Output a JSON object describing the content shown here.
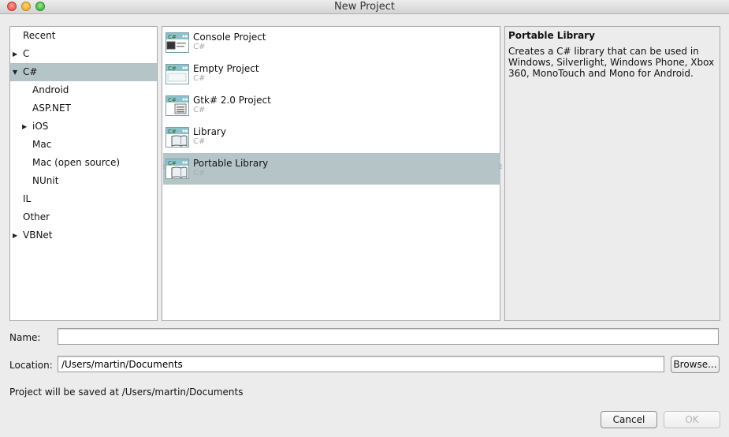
{
  "window": {
    "title": "New Project"
  },
  "categories": {
    "items": [
      {
        "label": "Recent",
        "has_children": false,
        "expanded": false,
        "level": 0,
        "selected": false
      },
      {
        "label": "C",
        "has_children": true,
        "expanded": false,
        "level": 0,
        "selected": false
      },
      {
        "label": "C#",
        "has_children": true,
        "expanded": true,
        "level": 0,
        "selected": true
      },
      {
        "label": "Android",
        "has_children": false,
        "expanded": false,
        "level": 1,
        "selected": false
      },
      {
        "label": "ASP.NET",
        "has_children": false,
        "expanded": false,
        "level": 1,
        "selected": false
      },
      {
        "label": "iOS",
        "has_children": true,
        "expanded": false,
        "level": 1,
        "selected": false
      },
      {
        "label": "Mac",
        "has_children": false,
        "expanded": false,
        "level": 1,
        "selected": false
      },
      {
        "label": "Mac (open source)",
        "has_children": false,
        "expanded": false,
        "level": 1,
        "selected": false
      },
      {
        "label": "NUnit",
        "has_children": false,
        "expanded": false,
        "level": 1,
        "selected": false
      },
      {
        "label": "IL",
        "has_children": false,
        "expanded": false,
        "level": 0,
        "selected": false
      },
      {
        "label": "Other",
        "has_children": false,
        "expanded": false,
        "level": 0,
        "selected": false
      },
      {
        "label": "VBNet",
        "has_children": true,
        "expanded": false,
        "level": 0,
        "selected": false
      }
    ]
  },
  "templates": {
    "items": [
      {
        "name": "Console Project",
        "language": "C#",
        "icon": "console-project-icon",
        "icon_badge": "C#",
        "selected": false
      },
      {
        "name": "Empty Project",
        "language": "C#",
        "icon": "empty-project-icon",
        "icon_badge": "C#",
        "selected": false
      },
      {
        "name": "Gtk# 2.0 Project",
        "language": "C#",
        "icon": "gtk-project-icon",
        "icon_badge": "C#",
        "selected": false
      },
      {
        "name": "Library",
        "language": "C#",
        "icon": "library-icon",
        "icon_badge": "C#",
        "selected": false
      },
      {
        "name": "Portable Library",
        "language": "C#",
        "icon": "portable-library-icon",
        "icon_badge": "C#",
        "selected": true
      }
    ]
  },
  "description": {
    "title": "Portable Library",
    "body": "Creates a C# library that can be used in Windows, Silverlight, Windows Phone, Xbox 360, MonoTouch and Mono for Android."
  },
  "form": {
    "name_label": "Name:",
    "name_value": "",
    "location_label": "Location:",
    "location_value": "/Users/martin/Documents",
    "browse_label": "Browse...",
    "save_path_text": "Project will be saved at /Users/martin/Documents"
  },
  "buttons": {
    "cancel_label": "Cancel",
    "ok_label": "OK",
    "ok_enabled": false
  },
  "colors": {
    "selection": "#b5c5c7",
    "window_bg": "#ececec",
    "panel_border": "#a8a8a8"
  }
}
